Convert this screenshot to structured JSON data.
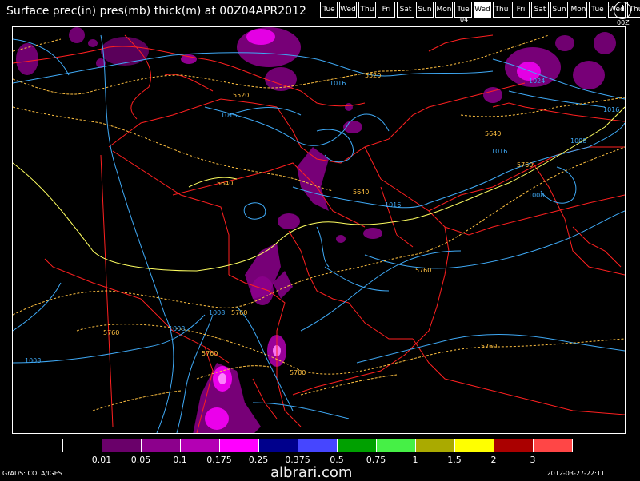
{
  "title": "Surface prec(in) pres(mb) thick(m) at 00Z04APR2012",
  "day_strip": [
    "Tue",
    "Wed",
    "Thu",
    "Fri",
    "Sat",
    "Sun",
    "Mon",
    "Tue",
    "Wed",
    "Thu",
    "Fri",
    "Sat",
    "Sun",
    "Mon",
    "Tue",
    "Wed",
    "Thu"
  ],
  "selected_day_index": 8,
  "selected_day_number": "04",
  "clock_label": "00Z",
  "contour_labels": {
    "pressure": [
      "1024",
      "1016",
      "1016",
      "1016",
      "1016",
      "1024",
      "1016",
      "1008",
      "1008",
      "1008",
      "1008",
      "1008"
    ],
    "thickness": [
      "5520",
      "5520",
      "5640",
      "5640",
      "5640",
      "5760",
      "5760",
      "5760",
      "5760",
      "5760",
      "5760",
      "5760"
    ]
  },
  "legend": {
    "colors": [
      "#000000",
      "#6a006a",
      "#8c008c",
      "#b400b4",
      "#ff00ff",
      "#00008c",
      "#4646ff",
      "#00a000",
      "#46f046",
      "#aaaa00",
      "#ffff00",
      "#aa0000",
      "#ff4646"
    ],
    "labels": [
      "0.01",
      "0.05",
      "0.1",
      "0.175",
      "0.25",
      "0.375",
      "0.5",
      "0.75",
      "1",
      "1.5",
      "2",
      "3"
    ]
  },
  "colors": {
    "pressure_contour": "#3fa9f5",
    "thickness_contour": "#ffc040",
    "thickness_5640": "#ffff60",
    "borders": "#ff2020"
  },
  "footer_left": "GrADS: COLA/IGES",
  "footer_right": "2012-03-27-22:11",
  "watermark": "albrari.com"
}
